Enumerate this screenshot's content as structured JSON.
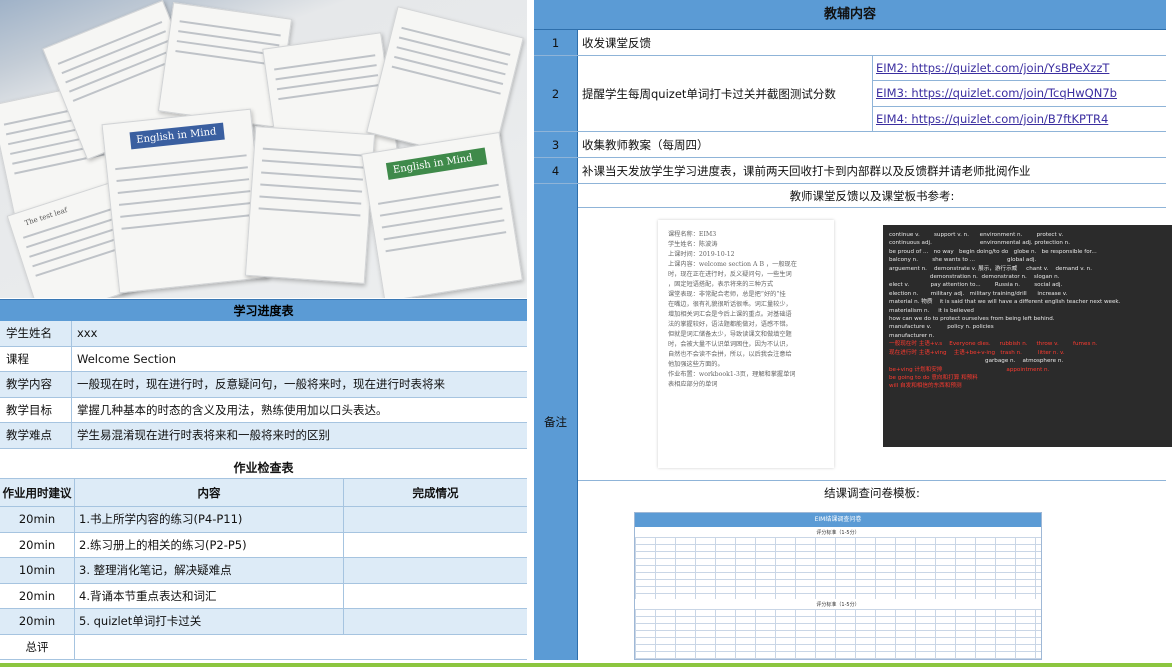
{
  "photo": {
    "book_cover_1": "English in Mind",
    "book_cover_2": "English in Mind",
    "sheet_text": "The test leaf"
  },
  "progress": {
    "title": "学习进度表",
    "rows": [
      {
        "label": "学生姓名",
        "value": "xxx"
      },
      {
        "label": "课程",
        "value": "Welcome Section"
      },
      {
        "label": "教学内容",
        "value": "一般现在时，现在进行时，反意疑问句，一般将来时，现在进行时表将来"
      },
      {
        "label": "教学目标",
        "value": "掌握几种基本的时态的含义及用法，熟练使用加以口头表达。"
      },
      {
        "label": "教学难点",
        "value": "学生易混淆现在进行时表将来和一般将来时的区别"
      }
    ]
  },
  "homework": {
    "title": "作业检查表",
    "headers": [
      "作业用时建议",
      "内容",
      "完成情况"
    ],
    "rows": [
      {
        "time": "20min",
        "content": "1.书上所学内容的练习(P4-P11)",
        "status": ""
      },
      {
        "time": "20min",
        "content": "2.练习册上的相关的练习(P2-P5)",
        "status": ""
      },
      {
        "time": "10min",
        "content": "3. 整理消化笔记，解决疑难点",
        "status": ""
      },
      {
        "time": "20min",
        "content": "4.背诵本节重点表达和词汇",
        "status": ""
      },
      {
        "time": "20min",
        "content": "5. quizlet单词打卡过关",
        "status": ""
      }
    ],
    "summary_label": "总评"
  },
  "right": {
    "title": "教辅内容",
    "items": [
      {
        "num": "1",
        "text": "收发课堂反馈"
      },
      {
        "num": "2",
        "text": "提醒学生每周quizet单词打卡过关并截图测试分数",
        "links": [
          "EIM2: https://quizlet.com/join/YsBPeXzzT",
          "EIM3: https://quizlet.com/join/TcqHwQN7b",
          "EIM4: https://quizlet.com/join/B7ftKPTR4"
        ]
      },
      {
        "num": "3",
        "text": "收集教师教案（每周四）"
      },
      {
        "num": "4",
        "text": "补课当天发放学生学习进度表，课前两天回收打卡到内部群以及反馈群并请老师批阅作业"
      }
    ],
    "note_label": "备注",
    "ref_title": "教师课堂反馈以及课堂板书参考:",
    "survey_title": "结课调查问卷模板:"
  },
  "plan_lines": [
    "课程名称：EIM3",
    "学生姓名：陈波涛",
    "上课时间：2019-10-12",
    "上课内容：welcome section A B ，一般现在",
    "时，现在正在进行时，反义疑问句，一些生词",
    "，固定短语搭配，表示将来的三种方式",
    "课堂表现：非常配合老师，总是把“好的”挂",
    "在嘴边，很有礼貌很听话很乖。词汇量较少，",
    "增加相关词汇会是今后上课的重点。对基础语",
    "法的掌握较好，语法题都能做对，语感不错。",
    "但就是词汇储备太少，导致读课文和做填空题",
    "时，会被大量不认识单词困住，因为不认识，",
    "自然也不会读不会拼，所以，以后我会注意给",
    "他加强这些方面的。",
    "作业布置：workbook1-3页，理解和掌握单词",
    "表相应部分的单词"
  ],
  "board_lines": [
    {
      "t": "continue v.        support v. n.      environment n.        protect v.",
      "red": false
    },
    {
      "t": "continuous adj.                           environmental adj. protection n.",
      "red": false
    },
    {
      "t": "be proud of ...   no way   begin doing/to do   globe n.   be responsible for...",
      "red": false
    },
    {
      "t": "balcony n.        she wants to ...                  global adj.",
      "red": false
    },
    {
      "t": "arguement n.    demonstrate v. 展示，游行示威     chant v.    demand v. n.",
      "red": false
    },
    {
      "t": "                       demonstration n.  demonstrator n.    slogan n.",
      "red": false
    },
    {
      "t": "elect v.            pay attention to...        Russia n.        social adj.",
      "red": false
    },
    {
      "t": "election n.       military adj.   military training/drill      increase v.",
      "red": false
    },
    {
      "t": "material n. 物质    it is said that we will have a different english teacher next week.",
      "red": false
    },
    {
      "t": "materialism n.     it is believed",
      "red": false
    },
    {
      "t": "how can we do to protect ourselves from being left behind.",
      "red": false
    },
    {
      "t": "manufacture v.         policy n. policies",
      "red": false
    },
    {
      "t": "manufacturer n.",
      "red": false
    },
    {
      "t": "一般现在时 主语+v.s    Everyone dies.     rubbish n.     throw v.        fumes n.",
      "red": true
    },
    {
      "t": "现在进行时 主语+ving    主语+be+v-ing   trash n.         litter n. v.",
      "red": true
    },
    {
      "t": "                                                      garbage n.    atmosphere n.",
      "red": false
    },
    {
      "t": "be+ving 计划和安排                                    appointment n.",
      "red": true
    },
    {
      "t": "be going to do 意向和打算 和预料",
      "red": true
    },
    {
      "t": "will 自发和相信的东西和预测",
      "red": true
    }
  ],
  "survey": {
    "title": "EIM结课调查问卷",
    "section_header": "评分标准（1-5分）"
  }
}
